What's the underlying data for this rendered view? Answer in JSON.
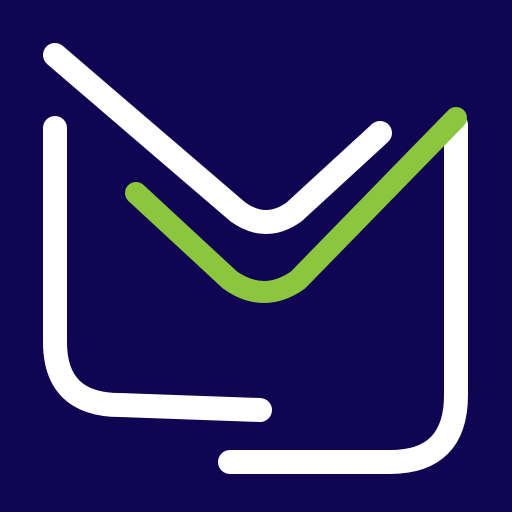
{
  "icon": {
    "name": "mail-logo-icon",
    "colors": {
      "background": "#100552",
      "envelope_stroke": "#ffffff",
      "accent_stroke": "#8cc63f"
    }
  }
}
